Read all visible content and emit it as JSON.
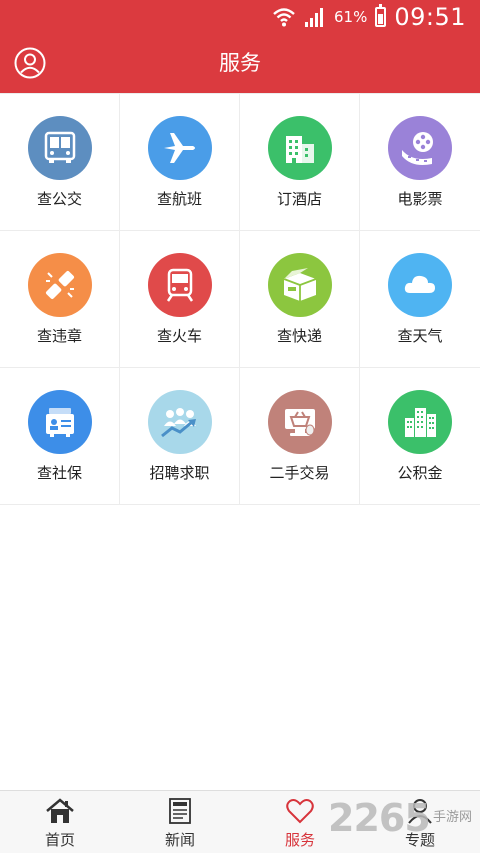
{
  "status": {
    "battery": "61%",
    "time": "09:51"
  },
  "header": {
    "title": "服务"
  },
  "services": [
    {
      "label": "查公交",
      "icon": "bus-icon",
      "color": "#5d8ec0"
    },
    {
      "label": "查航班",
      "icon": "airplane-icon",
      "color": "#4a9de8"
    },
    {
      "label": "订酒店",
      "icon": "hotel-icon",
      "color": "#3bc06a"
    },
    {
      "label": "电影票",
      "icon": "film-icon",
      "color": "#9a82d8"
    },
    {
      "label": "查违章",
      "icon": "violation-icon",
      "color": "#f58e48"
    },
    {
      "label": "查火车",
      "icon": "train-icon",
      "color": "#e04a4a"
    },
    {
      "label": "查快递",
      "icon": "package-icon",
      "color": "#8cc63f"
    },
    {
      "label": "查天气",
      "icon": "cloud-icon",
      "color": "#4fb4f2"
    },
    {
      "label": "查社保",
      "icon": "social-security-icon",
      "color": "#3d8ee8"
    },
    {
      "label": "招聘求职",
      "icon": "recruitment-icon",
      "color": "#a8d8ea"
    },
    {
      "label": "二手交易",
      "icon": "shopping-basket-icon",
      "color": "#c0827a"
    },
    {
      "label": "公积金",
      "icon": "buildings-icon",
      "color": "#3bc06a"
    }
  ],
  "nav": [
    {
      "label": "首页",
      "icon": "home-icon"
    },
    {
      "label": "新闻",
      "icon": "news-icon"
    },
    {
      "label": "服务",
      "icon": "heart-icon"
    },
    {
      "label": "专题",
      "icon": "topic-icon"
    }
  ],
  "accent_color": "#db3a3f",
  "watermark": {
    "number": "2265",
    "text": "手游网"
  }
}
